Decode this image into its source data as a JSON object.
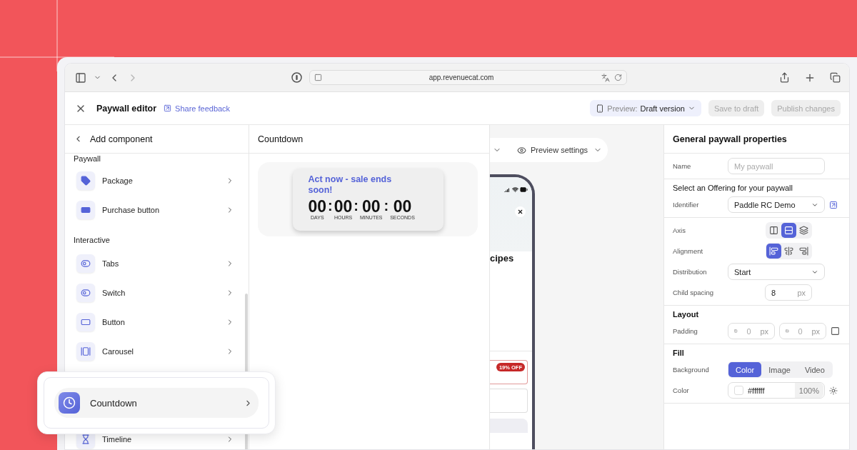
{
  "browser": {
    "url": "app.revenuecat.com",
    "nav": [
      {
        "kind": "back",
        "disabled": false
      },
      {
        "kind": "forward",
        "disabled": true
      }
    ]
  },
  "header": {
    "title": "Paywall editor",
    "feedback_link": "Share feedback",
    "preview": {
      "label": "Preview:",
      "value": "Draft version"
    },
    "buttons": [
      {
        "label": "Save to draft",
        "disabled": true
      },
      {
        "label": "Publish changes",
        "disabled": true
      }
    ]
  },
  "left_panel": {
    "title": "Add component",
    "sections": [
      {
        "heading": "Paywall",
        "items": [
          {
            "label": "Package",
            "kind": "tag"
          },
          {
            "label": "Purchase button",
            "kind": "purchase"
          }
        ]
      },
      {
        "heading": "Interactive",
        "items": [
          {
            "label": "Tabs",
            "kind": "tabs"
          },
          {
            "label": "Switch",
            "kind": "switch"
          },
          {
            "label": "Button",
            "kind": "button"
          },
          {
            "label": "Carousel",
            "kind": "carousel"
          },
          {
            "label": "Timeline",
            "kind": "timeline"
          }
        ]
      }
    ]
  },
  "floating_card": {
    "label": "Countdown"
  },
  "middle_panel": {
    "title": "Countdown",
    "countdown": {
      "headline": "Act now - sale ends soon!",
      "units": [
        {
          "value": "00",
          "label": "DAYS"
        },
        {
          "value": "00",
          "label": "HOURS"
        },
        {
          "value": "00",
          "label": "MINUTES"
        },
        {
          "value": "00",
          "label": "SECONDS"
        }
      ],
      "separator": ":"
    }
  },
  "preview": {
    "settings_label": "Preview settings",
    "phone": {
      "heading": "cipes",
      "badge": "19% OFF"
    }
  },
  "right_panel": {
    "title": "General paywall properties",
    "name": {
      "label": "Name",
      "placeholder": "My paywall"
    },
    "offering": {
      "heading": "Select an Offering for your paywall",
      "label": "Identifier",
      "value": "Paddle RC Demo"
    },
    "axis": {
      "label": "Axis",
      "options": [
        {
          "kind": "columns",
          "selected": false
        },
        {
          "kind": "rows",
          "selected": true
        },
        {
          "kind": "layers",
          "selected": false
        }
      ]
    },
    "alignment": {
      "label": "Alignment",
      "options": [
        {
          "kind": "start",
          "selected": true
        },
        {
          "kind": "center",
          "selected": false
        },
        {
          "kind": "end",
          "selected": false
        }
      ]
    },
    "distribution": {
      "label": "Distribution",
      "value": "Start"
    },
    "child_spacing": {
      "label": "Child spacing",
      "value": "8",
      "unit": "px"
    },
    "layout": {
      "heading": "Layout",
      "label": "Padding",
      "fields": [
        {
          "kind": "vertical",
          "placeholder": "0",
          "unit": "px"
        },
        {
          "kind": "horizontal",
          "placeholder": "0",
          "unit": "px"
        }
      ]
    },
    "fill": {
      "heading": "Fill",
      "background_label": "Background",
      "options": [
        {
          "label": "Color",
          "selected": true
        },
        {
          "label": "Image",
          "selected": false
        },
        {
          "label": "Video",
          "selected": false
        }
      ],
      "color_label": "Color",
      "color_value": "#ffffff",
      "opacity": "100%"
    }
  }
}
